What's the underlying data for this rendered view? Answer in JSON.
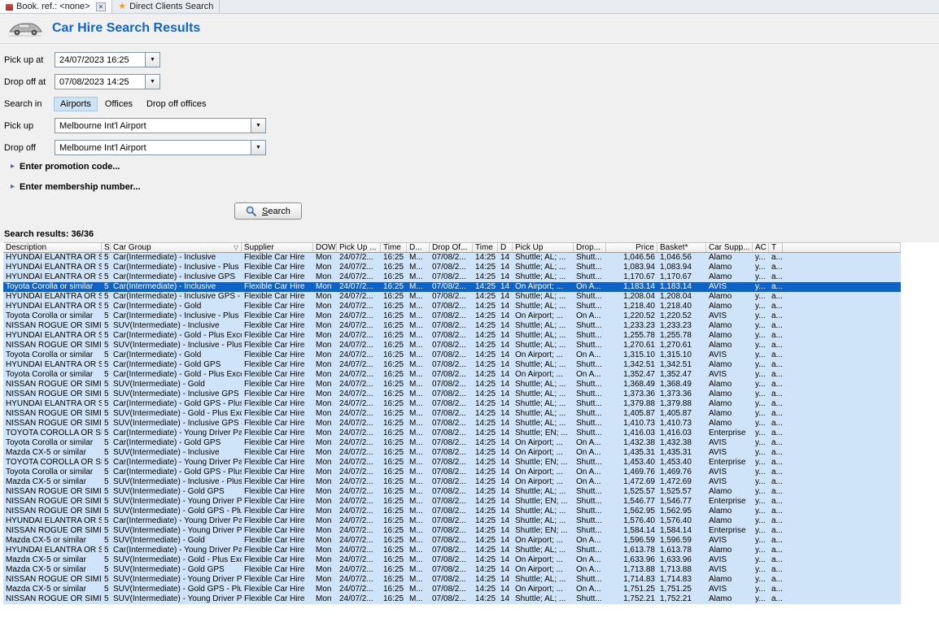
{
  "tabs": [
    {
      "label": "Book. ref.: <none>",
      "active": true,
      "closable": true
    },
    {
      "label": "Direct Clients Search",
      "active": false,
      "closable": false
    }
  ],
  "header": {
    "title": "Car Hire Search Results"
  },
  "icons": {
    "close": "✕",
    "direct_clients_star": "★",
    "dropdown_arrow": "▼",
    "expander_arrow": "▸",
    "filter": "▽"
  },
  "colors": {
    "title_blue": "#1464c8",
    "selected_row": "#0f62c6",
    "row_background": "#cfe4f8",
    "selected_text": "#ffffff"
  },
  "form": {
    "pickup_at": {
      "label": "Pick up at",
      "value": "24/07/2023 16:25"
    },
    "dropoff_at": {
      "label": "Drop off at",
      "value": "07/08/2023 14:25"
    },
    "search_in": {
      "label": "Search in",
      "options": [
        "Airports",
        "Offices",
        "Drop off offices"
      ],
      "selected": "Airports"
    },
    "pickup": {
      "label": "Pick up",
      "value": "Melbourne Int'l Airport"
    },
    "dropoff": {
      "label": "Drop off",
      "value": "Melbourne Int'l Airport"
    },
    "promo_expander": "Enter promotion code...",
    "membership_expander": "Enter membership number...",
    "search_button": "Search"
  },
  "results": {
    "summary": "Search results: 36/36",
    "columns": [
      "Description",
      "S",
      "Car Group",
      "Supplier",
      "DOW",
      "Pick Up ...",
      "Time",
      "D...",
      "Drop Of...",
      "Time",
      "D",
      "Pick Up",
      "Drop...",
      "Price",
      "Basket*",
      "Car Supp...",
      "AC",
      "T"
    ],
    "selected_row_index": 3,
    "shared": {
      "s": "5",
      "supplier": "Flexible Car Hire",
      "dow": "Mon",
      "pickup_date": "24/07/2...",
      "pickup_time": "16:25",
      "d1": "M...",
      "dropoff_date": "07/08/2...",
      "dropoff_time": "14:25",
      "days": "14",
      "ac": "y...",
      "t": "a..."
    },
    "rows": [
      {
        "desc": "HYUNDAI ELANTRA OR SIM...",
        "group": "Car(Intermediate) - Inclusive",
        "pick": "Shuttle; AL; ...",
        "drop": "Shutt...",
        "price": "1,046.56",
        "basket": "1,046.56",
        "car_supplier": "Alamo"
      },
      {
        "desc": "HYUNDAI ELANTRA OR SIM...",
        "group": "Car(Intermediate) - Inclusive - Plus Ex...",
        "pick": "Shuttle; AL; ...",
        "drop": "Shutt...",
        "price": "1,083.94",
        "basket": "1,083.94",
        "car_supplier": "Alamo"
      },
      {
        "desc": "HYUNDAI ELANTRA OR SIM...",
        "group": "Car(Intermediate) - Inclusive GPS",
        "pick": "Shuttle; AL; ...",
        "drop": "Shutt...",
        "price": "1,170.67",
        "basket": "1,170.67",
        "car_supplier": "Alamo"
      },
      {
        "desc": "Toyota Corolla or similar",
        "group": "Car(Intermediate) - Inclusive",
        "pick": "On Airport; ...",
        "drop": "On A...",
        "price": "1,183.14",
        "basket": "1,183.14",
        "car_supplier": "AVIS"
      },
      {
        "desc": "HYUNDAI ELANTRA OR SIM...",
        "group": "Car(Intermediate) - Inclusive GPS - Pl...",
        "pick": "Shuttle; AL; ...",
        "drop": "Shutt...",
        "price": "1,208.04",
        "basket": "1,208.04",
        "car_supplier": "Alamo"
      },
      {
        "desc": "HYUNDAI ELANTRA OR SIM...",
        "group": "Car(Intermediate) - Gold",
        "pick": "Shuttle; AL; ...",
        "drop": "Shutt...",
        "price": "1,218.40",
        "basket": "1,218.40",
        "car_supplier": "Alamo"
      },
      {
        "desc": "Toyota Corolla or similar",
        "group": "Car(Intermediate) - Inclusive - Plus Ex...",
        "pick": "On Airport; ...",
        "drop": "On A...",
        "price": "1,220.52",
        "basket": "1,220.52",
        "car_supplier": "AVIS"
      },
      {
        "desc": "NISSAN ROGUE OR SIMILAR",
        "group": "SUV(Intermediate) - Inclusive",
        "pick": "Shuttle; AL; ...",
        "drop": "Shutt...",
        "price": "1,233.23",
        "basket": "1,233.23",
        "car_supplier": "Alamo"
      },
      {
        "desc": "HYUNDAI ELANTRA OR SIM...",
        "group": "Car(Intermediate) - Gold - Plus Exces...",
        "pick": "Shuttle; AL; ...",
        "drop": "Shutt...",
        "price": "1,255.78",
        "basket": "1,255.78",
        "car_supplier": "Alamo"
      },
      {
        "desc": "NISSAN ROGUE OR SIMILAR",
        "group": "SUV(Intermediate) - Inclusive - Plus E...",
        "pick": "Shuttle; AL; ...",
        "drop": "Shutt...",
        "price": "1,270.61",
        "basket": "1,270.61",
        "car_supplier": "Alamo"
      },
      {
        "desc": "Toyota Corolla or similar",
        "group": "Car(Intermediate) - Gold",
        "pick": "On Airport; ...",
        "drop": "On A...",
        "price": "1,315.10",
        "basket": "1,315.10",
        "car_supplier": "AVIS"
      },
      {
        "desc": "HYUNDAI ELANTRA OR SIM...",
        "group": "Car(Intermediate) - Gold GPS",
        "pick": "Shuttle; AL; ...",
        "drop": "Shutt...",
        "price": "1,342.51",
        "basket": "1,342.51",
        "car_supplier": "Alamo"
      },
      {
        "desc": "Toyota Corolla or similar",
        "group": "Car(Intermediate) - Gold - Plus Exces...",
        "pick": "On Airport; ...",
        "drop": "On A...",
        "price": "1,352.47",
        "basket": "1,352.47",
        "car_supplier": "AVIS"
      },
      {
        "desc": "NISSAN ROGUE OR SIMILAR",
        "group": "SUV(Intermediate) - Gold",
        "pick": "Shuttle; AL; ...",
        "drop": "Shutt...",
        "price": "1,368.49",
        "basket": "1,368.49",
        "car_supplier": "Alamo"
      },
      {
        "desc": "NISSAN ROGUE OR SIMILAR",
        "group": "SUV(Intermediate) - Inclusive GPS",
        "pick": "Shuttle; AL; ...",
        "drop": "Shutt...",
        "price": "1,373.36",
        "basket": "1,373.36",
        "car_supplier": "Alamo"
      },
      {
        "desc": "HYUNDAI ELANTRA OR SIM...",
        "group": "Car(Intermediate) - Gold GPS - Plus E...",
        "pick": "Shuttle; AL; ...",
        "drop": "Shutt...",
        "price": "1,379.88",
        "basket": "1,379.88",
        "car_supplier": "Alamo"
      },
      {
        "desc": "NISSAN ROGUE OR SIMILAR",
        "group": "SUV(Intermediate) - Gold - Plus Exce...",
        "pick": "Shuttle; AL; ...",
        "drop": "Shutt...",
        "price": "1,405.87",
        "basket": "1,405.87",
        "car_supplier": "Alamo"
      },
      {
        "desc": "NISSAN ROGUE OR SIMILAR",
        "group": "SUV(Intermediate) - Inclusive GPS - P...",
        "pick": "Shuttle; AL; ...",
        "drop": "Shutt...",
        "price": "1,410.73",
        "basket": "1,410.73",
        "car_supplier": "Alamo"
      },
      {
        "desc": "TOYOTA COROLLA OR SIMIL...",
        "group": "Car(Intermediate) - Young Driver Pac...",
        "pick": "Shuttle; EN; ...",
        "drop": "Shutt...",
        "price": "1,416.03",
        "basket": "1,416.03",
        "car_supplier": "Enterprise"
      },
      {
        "desc": "Toyota Corolla or similar",
        "group": "Car(Intermediate) - Gold GPS",
        "pick": "On Airport; ...",
        "drop": "On A...",
        "price": "1,432.38",
        "basket": "1,432.38",
        "car_supplier": "AVIS"
      },
      {
        "desc": "Mazda CX-5 or similar",
        "group": "SUV(Intermediate) - Inclusive",
        "pick": "On Airport; ...",
        "drop": "On A...",
        "price": "1,435.31",
        "basket": "1,435.31",
        "car_supplier": "AVIS"
      },
      {
        "desc": "TOYOTA COROLLA OR SIMIL...",
        "group": "Car(Intermediate) - Young Driver Pac...",
        "pick": "Shuttle; EN; ...",
        "drop": "Shutt...",
        "price": "1,453.40",
        "basket": "1,453.40",
        "car_supplier": "Enterprise"
      },
      {
        "desc": "Toyota Corolla or similar",
        "group": "Car(Intermediate) - Gold GPS - Plus E...",
        "pick": "On Airport; ...",
        "drop": "On A...",
        "price": "1,469.76",
        "basket": "1,469.76",
        "car_supplier": "AVIS"
      },
      {
        "desc": "Mazda CX-5 or similar",
        "group": "SUV(Intermediate) - Inclusive - Plus E...",
        "pick": "On Airport; ...",
        "drop": "On A...",
        "price": "1,472.69",
        "basket": "1,472.69",
        "car_supplier": "AVIS"
      },
      {
        "desc": "NISSAN ROGUE OR SIMILAR",
        "group": "SUV(Intermediate) - Gold GPS",
        "pick": "Shuttle; AL; ...",
        "drop": "Shutt...",
        "price": "1,525.57",
        "basket": "1,525.57",
        "car_supplier": "Alamo"
      },
      {
        "desc": "NISSAN ROGUE OR SIMILAR",
        "group": "SUV(Intermediate) - Young Driver Pa...",
        "pick": "Shuttle; EN; ...",
        "drop": "Shutt...",
        "price": "1,546.77",
        "basket": "1,546.77",
        "car_supplier": "Enterprise"
      },
      {
        "desc": "NISSAN ROGUE OR SIMILAR",
        "group": "SUV(Intermediate) - Gold GPS - Plus ...",
        "pick": "Shuttle; AL; ...",
        "drop": "Shutt...",
        "price": "1,562.95",
        "basket": "1,562.95",
        "car_supplier": "Alamo"
      },
      {
        "desc": "HYUNDAI ELANTRA OR SIM...",
        "group": "Car(Intermediate) - Young Driver Pac...",
        "pick": "Shuttle; AL; ...",
        "drop": "Shutt...",
        "price": "1,576.40",
        "basket": "1,576.40",
        "car_supplier": "Alamo"
      },
      {
        "desc": "NISSAN ROGUE OR SIMILAR",
        "group": "SUV(Intermediate) - Young Driver Pa...",
        "pick": "Shuttle; EN; ...",
        "drop": "Shutt...",
        "price": "1,584.14",
        "basket": "1,584.14",
        "car_supplier": "Enterprise"
      },
      {
        "desc": "Mazda CX-5 or similar",
        "group": "SUV(Intermediate) - Gold",
        "pick": "On Airport; ...",
        "drop": "On A...",
        "price": "1,596.59",
        "basket": "1,596.59",
        "car_supplier": "AVIS"
      },
      {
        "desc": "HYUNDAI ELANTRA OR SIM...",
        "group": "Car(Intermediate) - Young Driver Pac...",
        "pick": "Shuttle; AL; ...",
        "drop": "Shutt...",
        "price": "1,613.78",
        "basket": "1,613.78",
        "car_supplier": "Alamo"
      },
      {
        "desc": "Mazda CX-5 or similar",
        "group": "SUV(Intermediate) - Gold - Plus Exce...",
        "pick": "On Airport; ...",
        "drop": "On A...",
        "price": "1,633.96",
        "basket": "1,633.96",
        "car_supplier": "AVIS"
      },
      {
        "desc": "Mazda CX-5 or similar",
        "group": "SUV(Intermediate) - Gold GPS",
        "pick": "On Airport; ...",
        "drop": "On A...",
        "price": "1,713.88",
        "basket": "1,713.88",
        "car_supplier": "AVIS"
      },
      {
        "desc": "NISSAN ROGUE OR SIMILAR",
        "group": "SUV(Intermediate) - Young Driver Pa...",
        "pick": "Shuttle; AL; ...",
        "drop": "Shutt...",
        "price": "1,714.83",
        "basket": "1,714.83",
        "car_supplier": "Alamo"
      },
      {
        "desc": "Mazda CX-5 or similar",
        "group": "SUV(Intermediate) - Gold GPS - Plus ...",
        "pick": "On Airport; ...",
        "drop": "On A...",
        "price": "1,751.25",
        "basket": "1,751.25",
        "car_supplier": "AVIS"
      },
      {
        "desc": "NISSAN ROGUE OR SIMILAR",
        "group": "SUV(Intermediate) - Young Driver Pa...",
        "pick": "Shuttle; AL; ...",
        "drop": "Shutt...",
        "price": "1,752.21",
        "basket": "1,752.21",
        "car_supplier": "Alamo"
      }
    ]
  }
}
